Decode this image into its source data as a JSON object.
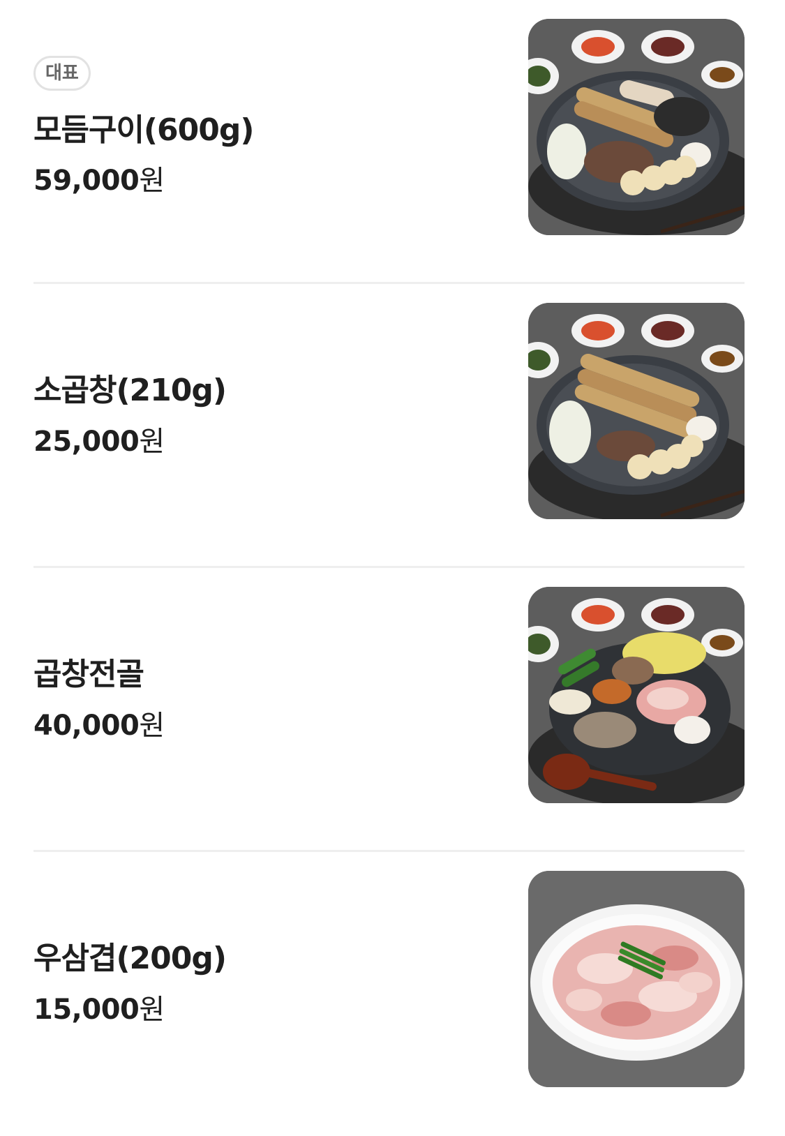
{
  "menu": [
    {
      "badge": "대표",
      "name": "모듬구이(600g)",
      "price_number": "59,000",
      "price_unit": "원",
      "image_icon": "mixed-grill-photo"
    },
    {
      "name": "소곱창(210g)",
      "price_number": "25,000",
      "price_unit": "원",
      "image_icon": "beef-tripe-grill-photo"
    },
    {
      "name": "곱창전골",
      "price_number": "40,000",
      "price_unit": "원",
      "image_icon": "tripe-hotpot-photo"
    },
    {
      "name": "우삼겹(200g)",
      "price_number": "15,000",
      "price_unit": "원",
      "image_icon": "beef-brisket-plate-photo"
    }
  ]
}
